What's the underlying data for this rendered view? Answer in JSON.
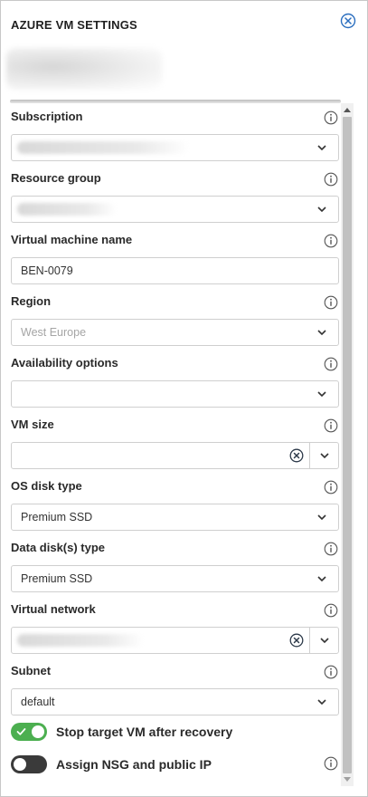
{
  "header": {
    "title": "AZURE VM SETTINGS"
  },
  "icons": {
    "close": "close-circle-icon",
    "info": "info-circle-icon",
    "chevron": "chevron-down-icon",
    "clear": "clear-circle-icon"
  },
  "colors": {
    "accent_blue": "#2a6ebf",
    "toggle_on": "#4caf50",
    "toggle_off": "#3a3a3a"
  },
  "fields": {
    "subscription": {
      "label": "Subscription",
      "value": ""
    },
    "resource_group": {
      "label": "Resource group",
      "value": ""
    },
    "vm_name": {
      "label": "Virtual machine name",
      "value": "BEN-0079"
    },
    "region": {
      "label": "Region",
      "value": "West Europe"
    },
    "availability": {
      "label": "Availability options",
      "value": ""
    },
    "vm_size": {
      "label": "VM size",
      "value": ""
    },
    "os_disk": {
      "label": "OS disk type",
      "value": "Premium SSD"
    },
    "data_disk": {
      "label": "Data disk(s) type",
      "value": "Premium SSD"
    },
    "vnet": {
      "label": "Virtual network",
      "value": ""
    },
    "subnet": {
      "label": "Subnet",
      "value": "default"
    }
  },
  "toggles": {
    "stop_vm": {
      "label": "Stop target VM after recovery",
      "state": "on"
    },
    "assign_nsg": {
      "label": "Assign NSG and public IP",
      "state": "off"
    }
  }
}
